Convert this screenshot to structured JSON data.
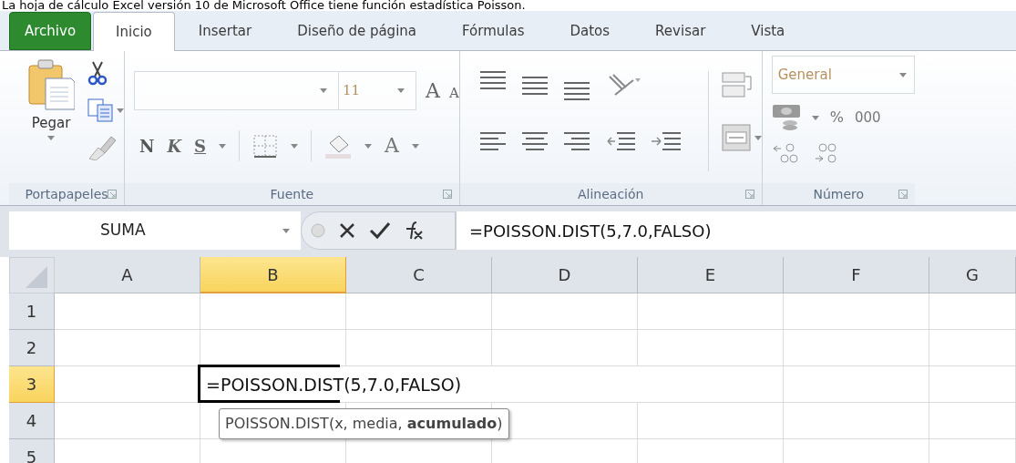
{
  "caption": "La hoja de cálculo Excel versión 10 de Microsoft Office tiene función estadística Poisson.",
  "tabs": [
    {
      "label": "Archivo",
      "kind": "file",
      "selected": false
    },
    {
      "label": "Inicio",
      "kind": "tab",
      "selected": true
    },
    {
      "label": "Insertar",
      "kind": "tab",
      "selected": false
    },
    {
      "label": "Diseño de página",
      "kind": "tab",
      "selected": false
    },
    {
      "label": "Fórmulas",
      "kind": "tab",
      "selected": false
    },
    {
      "label": "Datos",
      "kind": "tab",
      "selected": false
    },
    {
      "label": "Revisar",
      "kind": "tab",
      "selected": false
    },
    {
      "label": "Vista",
      "kind": "tab",
      "selected": false
    }
  ],
  "ribbon": {
    "clipboard": {
      "label": "Portapapeles",
      "paste": "Pegar"
    },
    "font": {
      "label": "Fuente",
      "font_size": "11",
      "grow": "A",
      "shrink": "A",
      "bold": "N",
      "italic": "K",
      "underline": "S",
      "font_color": "A"
    },
    "alignment": {
      "label": "Alineación"
    },
    "number": {
      "label": "Número",
      "format": "General",
      "percent": "%",
      "thousands": "000"
    }
  },
  "formula_bar": {
    "name_box": "SUMA",
    "formula": "=POISSON.DIST(5,7.0,FALSO)"
  },
  "sheet": {
    "columns": [
      {
        "label": "A",
        "selected": false
      },
      {
        "label": "B",
        "selected": true
      },
      {
        "label": "C",
        "selected": false
      },
      {
        "label": "D",
        "selected": false
      },
      {
        "label": "E",
        "selected": false
      },
      {
        "label": "F",
        "selected": false
      },
      {
        "label": "G",
        "selected": false
      }
    ],
    "rows": [
      {
        "label": "1",
        "selected": false
      },
      {
        "label": "2",
        "selected": false
      },
      {
        "label": "3",
        "selected": true
      },
      {
        "label": "4",
        "selected": false
      },
      {
        "label": "5",
        "selected": false
      }
    ],
    "active_cell": {
      "value": "=POISSON.DIST(5,7.0,FALSO)"
    },
    "tooltip": "POISSON.DIST(x, media, **acumulado**)"
  }
}
